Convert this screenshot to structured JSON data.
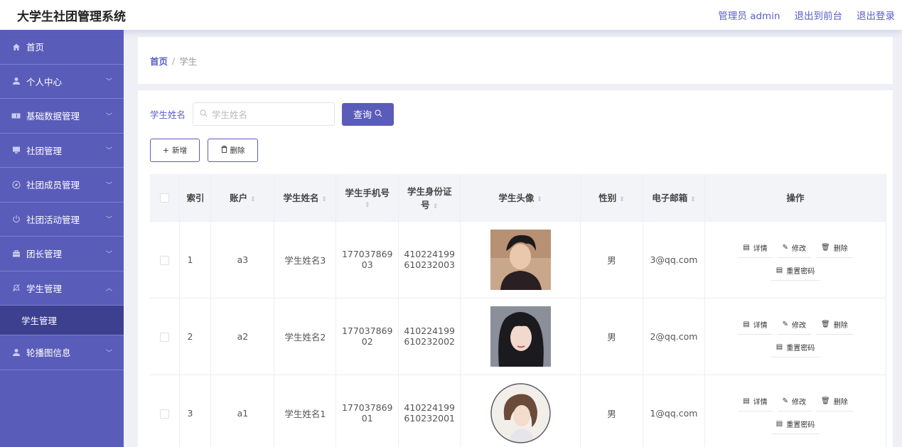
{
  "header": {
    "title": "大学生社团管理系统",
    "admin_label": "管理员 admin",
    "back_label": "退出到前台",
    "logout_label": "退出登录"
  },
  "sidebar": {
    "items": [
      {
        "label": "首页",
        "icon": "home-icon"
      },
      {
        "label": "个人中心",
        "icon": "user-icon"
      },
      {
        "label": "基础数据管理",
        "icon": "ticket-icon"
      },
      {
        "label": "社团管理",
        "icon": "monitor-icon"
      },
      {
        "label": "社团成员管理",
        "icon": "compass-icon"
      },
      {
        "label": "社团活动管理",
        "icon": "power-icon"
      },
      {
        "label": "团长管理",
        "icon": "briefcase-icon"
      },
      {
        "label": "学生管理",
        "icon": "bell-icon"
      },
      {
        "label": "轮播图信息",
        "icon": "user-icon"
      }
    ],
    "sub_item": "学生管理"
  },
  "breadcrumb": {
    "home": "首页",
    "sep": "/",
    "current": "学生"
  },
  "search": {
    "label": "学生姓名",
    "placeholder": "学生姓名",
    "button": "查询"
  },
  "actions": {
    "add": "新增",
    "delete": "删除"
  },
  "table": {
    "headers": {
      "index": "索引",
      "account": "账户",
      "name": "学生姓名",
      "phone": "学生手机号",
      "idcard_1": "学生身份证",
      "idcard_2": "号",
      "avatar": "学生头像",
      "gender": "性别",
      "email": "电子邮箱",
      "ops": "操作"
    },
    "rows": [
      {
        "index": "1",
        "account": "a3",
        "name": "学生姓名3",
        "phone_1": "177037869",
        "phone_2": "03",
        "id_1": "410224199",
        "id_2": "610232003",
        "gender": "男",
        "email": "3@qq.com"
      },
      {
        "index": "2",
        "account": "a2",
        "name": "学生姓名2",
        "phone_1": "177037869",
        "phone_2": "02",
        "id_1": "410224199",
        "id_2": "610232002",
        "gender": "男",
        "email": "2@qq.com"
      },
      {
        "index": "3",
        "account": "a1",
        "name": "学生姓名1",
        "phone_1": "177037869",
        "phone_2": "01",
        "id_1": "410224199",
        "id_2": "610232001",
        "gender": "男",
        "email": "1@qq.com"
      }
    ],
    "op_labels": {
      "detail": "详情",
      "edit": "修改",
      "delete": "删除",
      "reset": "重置密码"
    }
  },
  "colors": {
    "accent": "#5a5cba",
    "link": "#5a5fc4"
  }
}
